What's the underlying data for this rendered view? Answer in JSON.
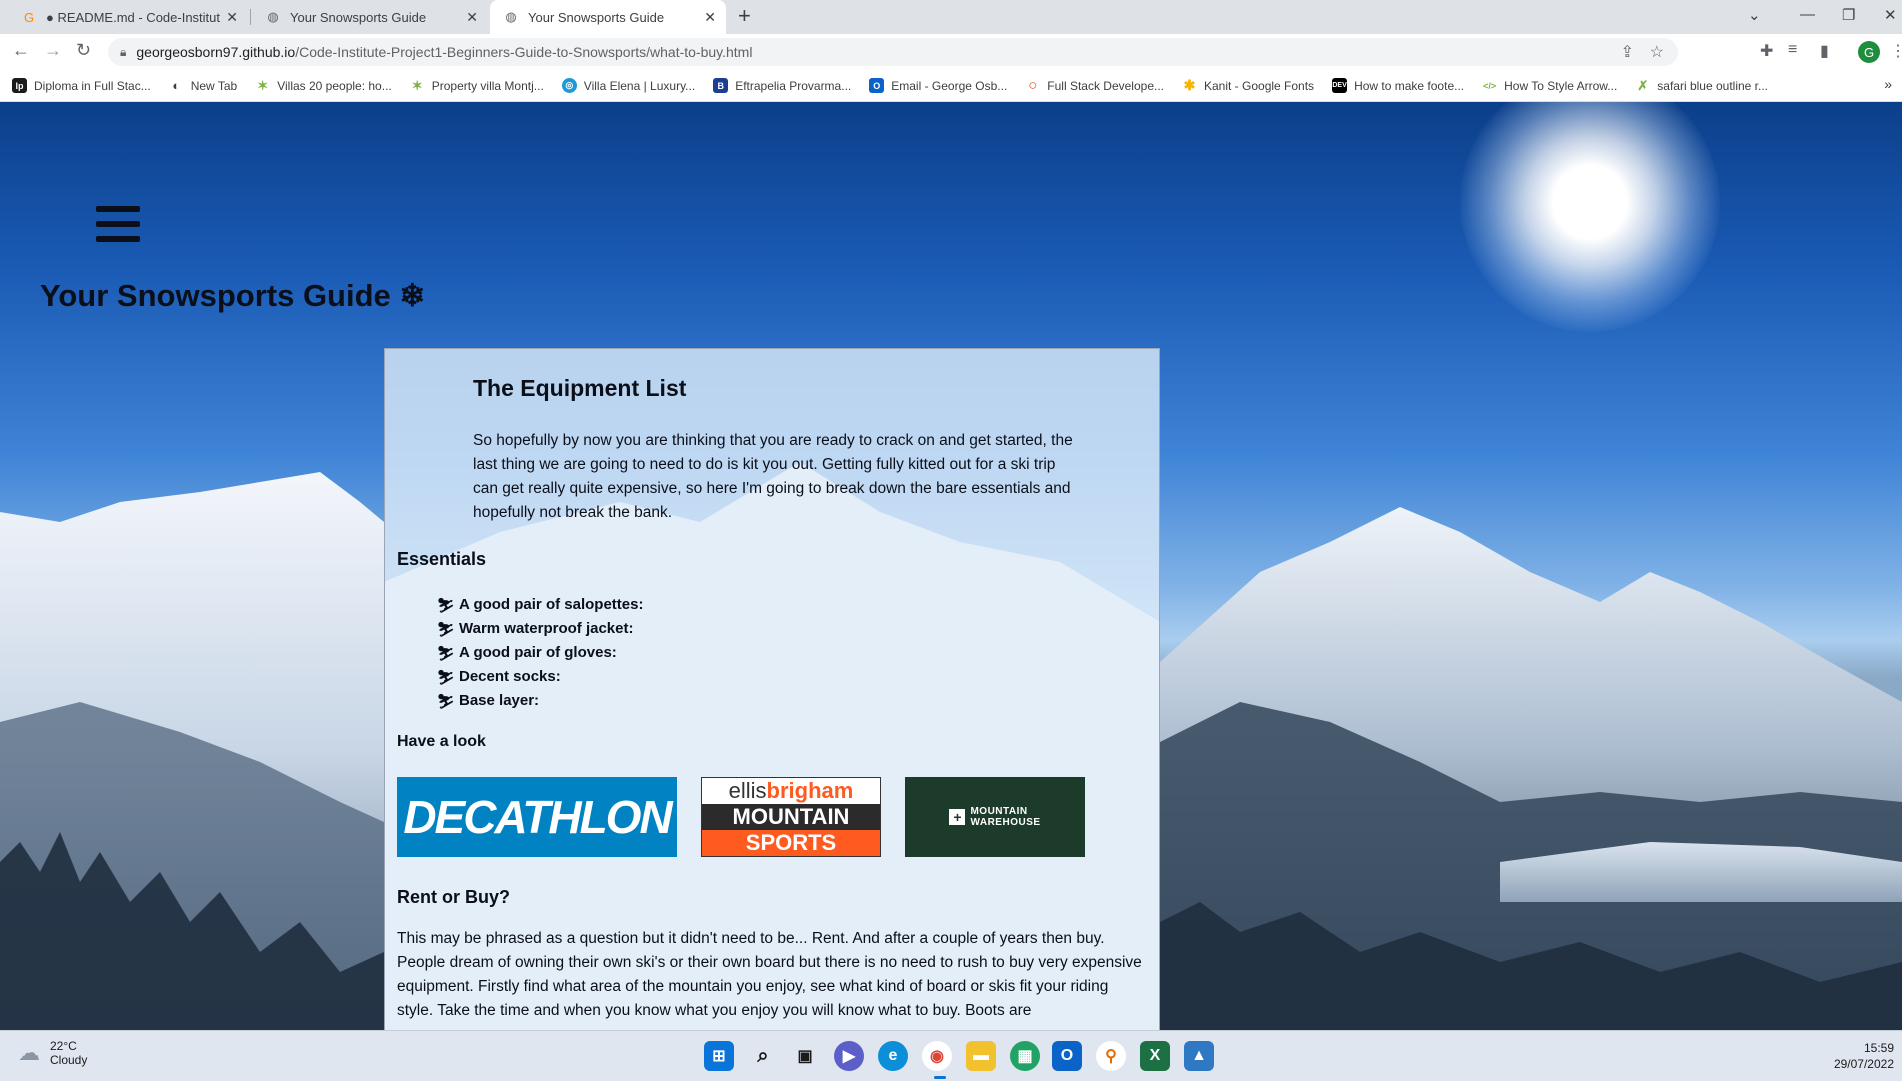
{
  "browser": {
    "tabs": [
      {
        "title": "● README.md - Code-Institute-P",
        "icon": "gitpod-icon",
        "color": "#ff8a00"
      },
      {
        "title": "Your Snowsports Guide",
        "icon": "globe-icon",
        "color": "#5f6368"
      },
      {
        "title": "Your Snowsports Guide",
        "icon": "globe-icon",
        "color": "#5f6368"
      }
    ],
    "url_host": "georgeosborn97.github.io",
    "url_path": "/Code-Institute-Project1-Beginners-Guide-to-Snowsports/what-to-buy.html",
    "bookmarks": [
      {
        "label": "Diploma in Full Stac...",
        "badge": "lp",
        "color": "#1b1b1b"
      },
      {
        "label": "New Tab",
        "badge": "◐",
        "color": "#3c4043"
      },
      {
        "label": "Villas 20 people: ho...",
        "badge": "✶",
        "color": "#7cb342"
      },
      {
        "label": "Property villa Montj...",
        "badge": "✶",
        "color": "#7cb342"
      },
      {
        "label": "Villa Elena | Luxury...",
        "badge": "◎",
        "color": "#1a9bd7"
      },
      {
        "label": "Eftrapelia Provarma...",
        "badge": "B",
        "color": "#1c3f94"
      },
      {
        "label": "Email - George Osb...",
        "badge": "O",
        "color": "#0a64c8"
      },
      {
        "label": "Full Stack Develope...",
        "badge": "○",
        "color": "#e64a19"
      },
      {
        "label": "Kanit - Google Fonts",
        "badge": "✱",
        "color": "#f4b400"
      },
      {
        "label": "How to make foote...",
        "badge": "DEV",
        "color": "#000000"
      },
      {
        "label": "How To Style Arrow...",
        "badge": "</>",
        "color": "#7cb342"
      },
      {
        "label": "safari blue outline r...",
        "badge": "✗",
        "color": "#7cb342"
      }
    ]
  },
  "site": {
    "title": "Your Snowsports Guide ❄",
    "heading": "The Equipment List",
    "intro": "So hopefully by now you are thinking that you are ready to crack on and get started, the last thing we are going to need to do is kit you out. Getting fully kitted out for a ski trip can get really quite expensive, so here I'm going to break down the bare essentials and hopefully not break the bank.",
    "essentials_heading": "Essentials",
    "essentials": [
      "A good pair of salopettes:",
      "Warm waterproof jacket:",
      "A good pair of gloves:",
      "Decent socks:",
      "Base layer:"
    ],
    "have_a_look": "Have a look",
    "logos": {
      "decathlon": "DECATHLON",
      "ellis_top_a": "ellis",
      "ellis_top_b": "brigham",
      "ellis_mid": "MOUNTAIN",
      "ellis_bot": "SPORTS",
      "mw_line1": "MOUNTAIN",
      "mw_line2": "WAREHOUSE"
    },
    "rent_heading": "Rent or Buy?",
    "rent_text": "This may be phrased as a question but it didn't need to be... Rent. And after a couple of years then buy. People dream of owning their own ski's or their own board but there is no need to rush to buy very expensive equipment. Firstly find what area of the mountain you enjoy, see what kind of board or skis fit your riding style. Take the time and when you know what you enjoy you will know what to buy. Boots are"
  },
  "taskbar": {
    "temperature": "22°C",
    "condition": "Cloudy",
    "time": "15:59",
    "date": "29/07/2022"
  }
}
